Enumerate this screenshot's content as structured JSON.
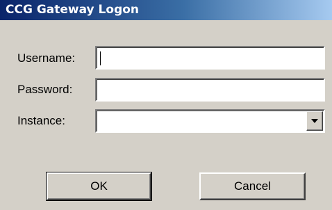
{
  "window": {
    "title": "CCG Gateway Logon"
  },
  "form": {
    "username": {
      "label": "Username:",
      "value": ""
    },
    "password": {
      "label": "Password:",
      "value": ""
    },
    "instance": {
      "label": "Instance:",
      "value": "",
      "button_icon": "dropdown-arrow-icon"
    }
  },
  "buttons": {
    "ok_label": "OK",
    "cancel_label": "Cancel"
  },
  "colors": {
    "dialog_bg": "#d4d0c8",
    "titlebar_start": "#0a246a",
    "titlebar_end": "#a6caf0",
    "title_text": "#ffffff"
  }
}
